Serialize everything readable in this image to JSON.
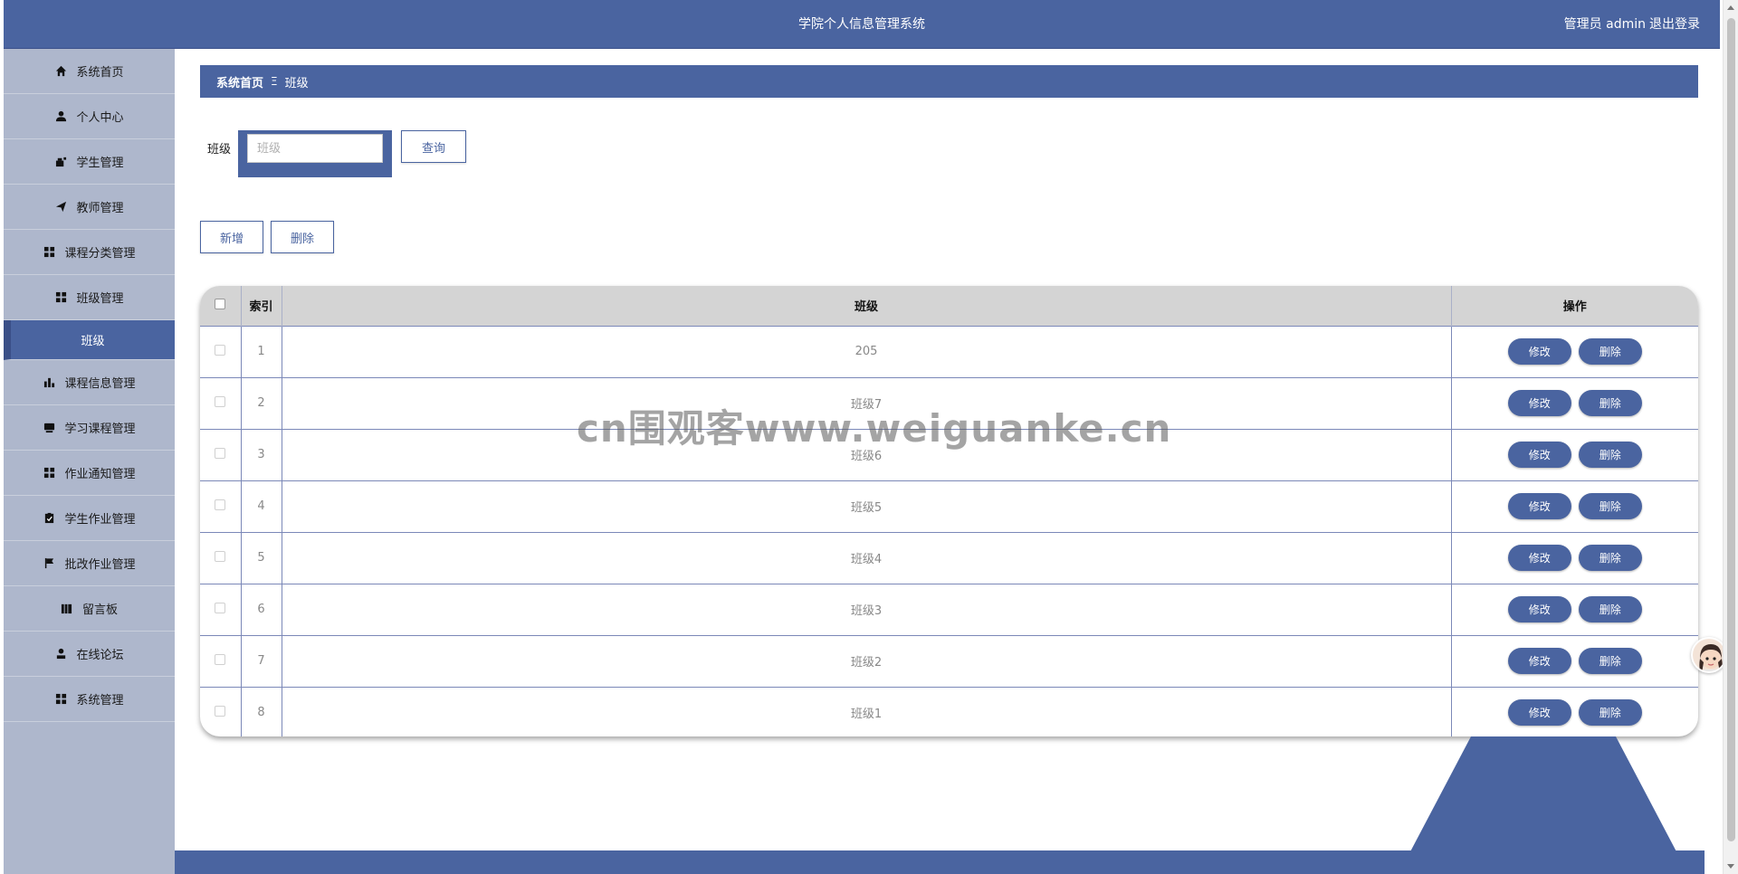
{
  "header": {
    "title": "学院个人信息管理系统",
    "user": "管理员 admin",
    "logout": "退出登录"
  },
  "sidebar": {
    "items": [
      {
        "label": "系统首页",
        "icon": "home-icon"
      },
      {
        "label": "个人中心",
        "icon": "user-icon"
      },
      {
        "label": "学生管理",
        "icon": "tools-icon"
      },
      {
        "label": "教师管理",
        "icon": "send-icon"
      },
      {
        "label": "课程分类管理",
        "icon": "grid-icon"
      },
      {
        "label": "班级管理",
        "icon": "grid-icon"
      },
      {
        "label": "班级",
        "icon": "",
        "active": true
      },
      {
        "label": "课程信息管理",
        "icon": "bar-chart-icon"
      },
      {
        "label": "学习课程管理",
        "icon": "tray-icon"
      },
      {
        "label": "作业通知管理",
        "icon": "grid-icon"
      },
      {
        "label": "学生作业管理",
        "icon": "clipboard-icon"
      },
      {
        "label": "批改作业管理",
        "icon": "flag-icon"
      },
      {
        "label": "留言板",
        "icon": "book-icon"
      },
      {
        "label": "在线论坛",
        "icon": "person-icon"
      },
      {
        "label": "系统管理",
        "icon": "grid-icon"
      }
    ]
  },
  "breadcrumb": {
    "home": "系统首页",
    "sep": "Ξ",
    "current": "班级"
  },
  "search": {
    "label": "班级",
    "placeholder": "班级",
    "button": "查询"
  },
  "actions": {
    "add": "新增",
    "delete": "删除"
  },
  "table": {
    "columns": [
      "索引",
      "班级",
      "操作"
    ],
    "rows": [
      {
        "index": "1",
        "name": "205"
      },
      {
        "index": "2",
        "name": "班级7"
      },
      {
        "index": "3",
        "name": "班级6"
      },
      {
        "index": "4",
        "name": "班级5"
      },
      {
        "index": "5",
        "name": "班级4"
      },
      {
        "index": "6",
        "name": "班级3"
      },
      {
        "index": "7",
        "name": "班级2"
      },
      {
        "index": "8",
        "name": "班级1"
      }
    ],
    "edit_label": "修改",
    "delete_label": "删除"
  },
  "watermark": "cn围观客www.weiguanke.cn",
  "colors": {
    "primary": "#4a64a0",
    "sidebar_bg": "#aeb7cc",
    "header_row": "#d4d4d4"
  }
}
